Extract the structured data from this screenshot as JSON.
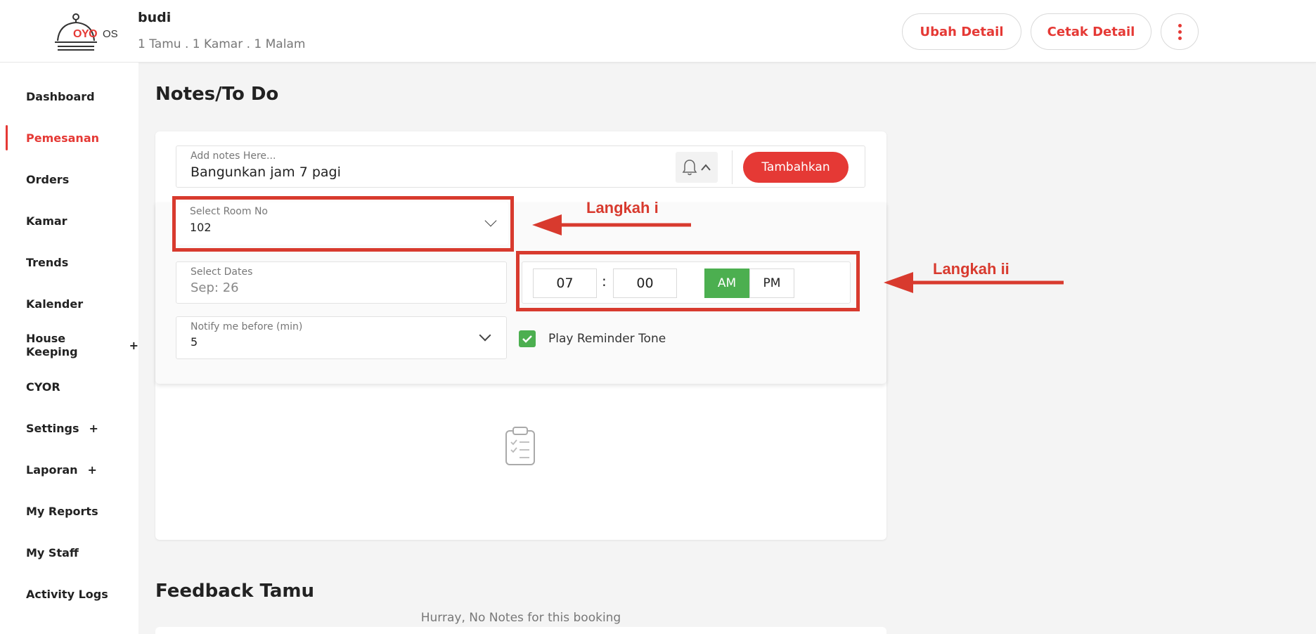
{
  "header": {
    "logo_brand": "OYO",
    "logo_suffix": "OS",
    "guest_name": "budi",
    "guest_summary": "1 Tamu . 1 Kamar . 1 Malam",
    "buttons": {
      "edit": "Ubah Detail",
      "print": "Cetak Detail"
    }
  },
  "sidebar": {
    "items": [
      {
        "label": "Dashboard",
        "plus": ""
      },
      {
        "label": "Pemesanan",
        "plus": ""
      },
      {
        "label": "Orders",
        "plus": ""
      },
      {
        "label": "Kamar",
        "plus": ""
      },
      {
        "label": "Trends",
        "plus": ""
      },
      {
        "label": "Kalender",
        "plus": ""
      },
      {
        "label": "House Keeping",
        "plus": "+"
      },
      {
        "label": "CYOR",
        "plus": ""
      },
      {
        "label": "Settings",
        "plus": "+"
      },
      {
        "label": "Laporan",
        "plus": "+"
      },
      {
        "label": "My Reports",
        "plus": ""
      },
      {
        "label": "My Staff",
        "plus": ""
      },
      {
        "label": "Activity Logs",
        "plus": ""
      }
    ],
    "active": "Pemesanan"
  },
  "notes": {
    "title": "Notes/To Do",
    "note_input": {
      "label": "Add notes Here...",
      "value": "Bangunkan jam 7 pagi"
    },
    "add_button": "Tambahkan",
    "room": {
      "label": "Select Room No",
      "value": "102"
    },
    "dates": {
      "label": "Select Dates",
      "value": "Sep: 26"
    },
    "time": {
      "hour": "07",
      "separator": ":",
      "minute": "00",
      "am": "AM",
      "pm": "PM",
      "selected": "AM"
    },
    "notify": {
      "label": "Notify me before (min)",
      "value": "5"
    },
    "reminder_tone": {
      "label": "Play Reminder Tone",
      "checked": true
    },
    "empty_message": "Hurray, No Notes for this booking"
  },
  "feedback": {
    "title": "Feedback Tamu"
  },
  "annotations": {
    "step1": "Langkah i",
    "step2": "Langkah ii",
    "color": "#d83a2e"
  },
  "colors": {
    "accent": "#e53935",
    "success": "#4caf50"
  }
}
